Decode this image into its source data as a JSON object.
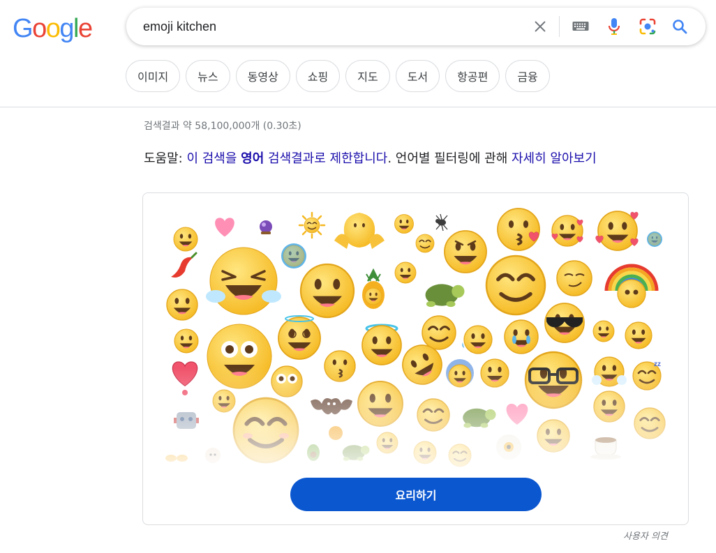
{
  "logo": {
    "text": "Google"
  },
  "search": {
    "query": "emoji kitchen"
  },
  "chips": [
    "이미지",
    "뉴스",
    "동영상",
    "쇼핑",
    "지도",
    "도서",
    "항공편",
    "금융"
  ],
  "result_stats": "검색결과 약 58,100,000개 (0.30초)",
  "language_tip": {
    "prefix": "도움말: ",
    "link1_a": "이 검색을 ",
    "link1_bold": "영어",
    "link1_b": " 검색결과로 제한합니다",
    "middle": ". 언어별 필터링에 관해 ",
    "link2": "자세히 알아보기"
  },
  "emoji_kitchen": {
    "button_label": "요리하기"
  },
  "feedback": "사용자 의견",
  "colors": {
    "accent": "#0b57d0",
    "link": "#1a0dab",
    "emoji_face": "#fcc934",
    "emoji_outline": "#e0a000"
  }
}
